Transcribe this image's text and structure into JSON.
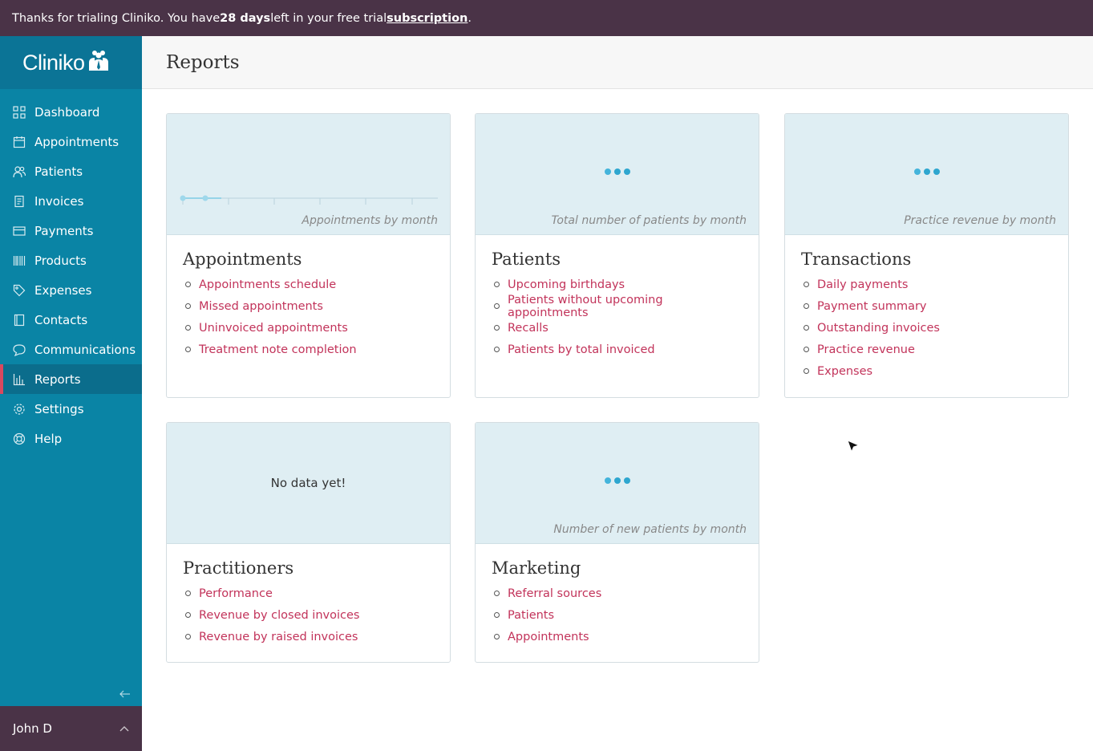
{
  "banner": {
    "prefix": "Thanks for trialing Cliniko. You have ",
    "days": "28 days",
    "middle": " left in your free trial ",
    "link": "subscription",
    "suffix": "."
  },
  "sidebar": {
    "logo": "Cliniko",
    "items": [
      {
        "label": "Dashboard",
        "icon": "grid-icon"
      },
      {
        "label": "Appointments",
        "icon": "calendar-icon"
      },
      {
        "label": "Patients",
        "icon": "users-icon"
      },
      {
        "label": "Invoices",
        "icon": "invoice-icon"
      },
      {
        "label": "Payments",
        "icon": "card-icon"
      },
      {
        "label": "Products",
        "icon": "barcode-icon"
      },
      {
        "label": "Expenses",
        "icon": "tag-icon"
      },
      {
        "label": "Contacts",
        "icon": "book-icon"
      },
      {
        "label": "Communications",
        "icon": "chat-icon"
      },
      {
        "label": "Reports",
        "icon": "bar-chart-icon",
        "active": true
      },
      {
        "label": "Settings",
        "icon": "gear-icon"
      },
      {
        "label": "Help",
        "icon": "lifebuoy-icon"
      }
    ],
    "collapse_icon": "arrow-left-icon",
    "user": "John D"
  },
  "header": {
    "title": "Reports"
  },
  "cards": [
    {
      "title": "Appointments",
      "chart_caption": "Appointments by month",
      "links": [
        "Appointments schedule",
        "Missed appointments",
        "Uninvoiced appointments",
        "Treatment note completion"
      ]
    },
    {
      "title": "Patients",
      "chart_caption": "Total number of patients by month",
      "links": [
        "Upcoming birthdays",
        "Patients without upcoming appointments",
        "Recalls",
        "Patients by total invoiced"
      ]
    },
    {
      "title": "Transactions",
      "chart_caption": "Practice revenue by month",
      "links": [
        "Daily payments",
        "Payment summary",
        "Outstanding invoices",
        "Practice revenue",
        "Expenses"
      ]
    },
    {
      "title": "Practitioners",
      "chart_caption": "No data yet!",
      "links": [
        "Performance",
        "Revenue by closed invoices",
        "Revenue by raised invoices"
      ]
    },
    {
      "title": "Marketing",
      "chart_caption": "Number of new patients by month",
      "links": [
        "Referral sources",
        "Patients",
        "Appointments"
      ]
    }
  ],
  "colors": {
    "sidebar": "#0a84a5",
    "banner": "#4a3347",
    "link": "#c2335a",
    "chart_bg": "#dfeef3",
    "active_indicator": "#d9485f"
  }
}
